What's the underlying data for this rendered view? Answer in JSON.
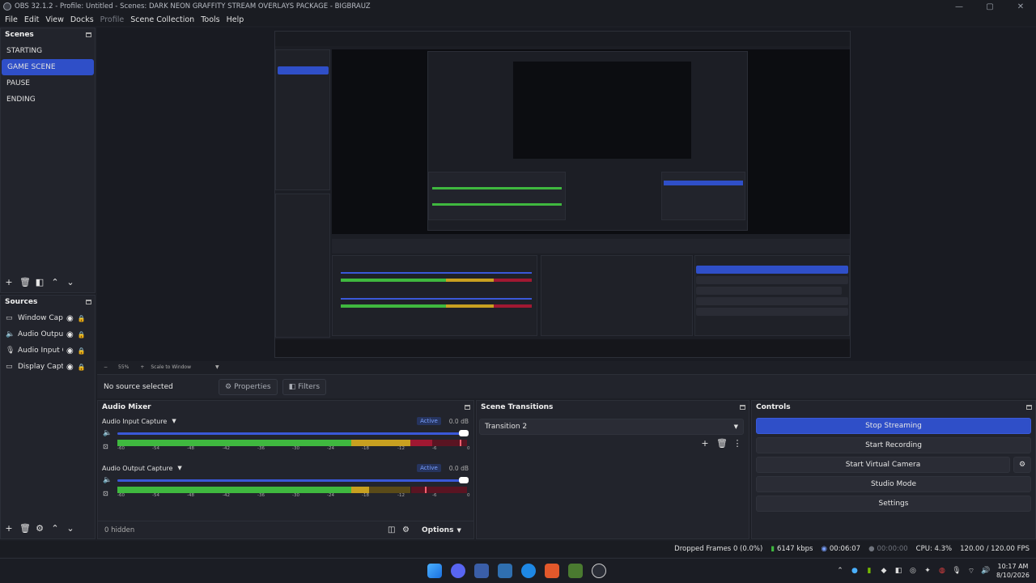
{
  "window": {
    "title": "OBS 32.1.2 - Profile: Untitled - Scenes: DARK NEON GRAFFITY STREAM OVERLAYS PACKAGE - BIGBRAUZ",
    "minimize": "—",
    "maximize": "▢",
    "close": "✕"
  },
  "menu": {
    "file": "File",
    "edit": "Edit",
    "view": "View",
    "docks": "Docks",
    "profile": "Profile",
    "scene_collection": "Scene Collection",
    "tools": "Tools",
    "help": "Help"
  },
  "scenes": {
    "title": "Scenes",
    "items": [
      "STARTING",
      "GAME SCENE",
      "PAUSE",
      "ENDING"
    ],
    "active_index": 1
  },
  "sources": {
    "title": "Sources",
    "items": [
      {
        "name": "Window Capture",
        "icon": "window-icon"
      },
      {
        "name": "Audio Output Capture",
        "icon": "speaker-icon"
      },
      {
        "name": "Audio Input Capture",
        "icon": "microphone-icon"
      },
      {
        "name": "Display Capture",
        "icon": "monitor-icon"
      }
    ]
  },
  "zoom": {
    "value": "55%",
    "mode": "Scale to Window",
    "minus": "−",
    "plus": "+"
  },
  "properties_bar": {
    "no_source": "No source selected",
    "properties": "Properties",
    "filters": "Filters"
  },
  "audio_mixer": {
    "title": "Audio Mixer",
    "channels": [
      {
        "name": "Audio Input Capture",
        "status": "Active",
        "db": "0.0 dB",
        "volume": 1.0,
        "level": 0.9,
        "peak": 0.98
      },
      {
        "name": "Audio Output Capture",
        "status": "Active",
        "db": "0.0 dB",
        "volume": 1.0,
        "level": 0.72,
        "peak": 0.88
      }
    ],
    "ticks": [
      "-60",
      "-54",
      "-48",
      "-42",
      "-36",
      "-30",
      "-24",
      "-18",
      "-12",
      "-6",
      "0"
    ],
    "hidden": "0 hidden",
    "options": "Options"
  },
  "scene_transitions": {
    "title": "Scene Transitions",
    "selected": "Transition 2"
  },
  "controls": {
    "title": "Controls",
    "stop_streaming": "Stop Streaming",
    "start_recording": "Start Recording",
    "start_virtual_camera": "Start Virtual Camera",
    "studio_mode": "Studio Mode",
    "settings": "Settings"
  },
  "status": {
    "dropped_frames": "Dropped Frames 0 (0.0%)",
    "bitrate": "6147 kbps",
    "stream_time": "00:06:07",
    "record_time": "00:00:00",
    "cpu": "CPU: 4.3%",
    "fps": "120.00 / 120.00 FPS"
  },
  "taskbar": {
    "time": "10:17 AM",
    "date": "8/10/2026"
  },
  "colors": {
    "accent": "#2f4fc8",
    "meter_green": "#3fb83f",
    "meter_yellow": "#c8a020",
    "meter_red": "#a01832"
  }
}
